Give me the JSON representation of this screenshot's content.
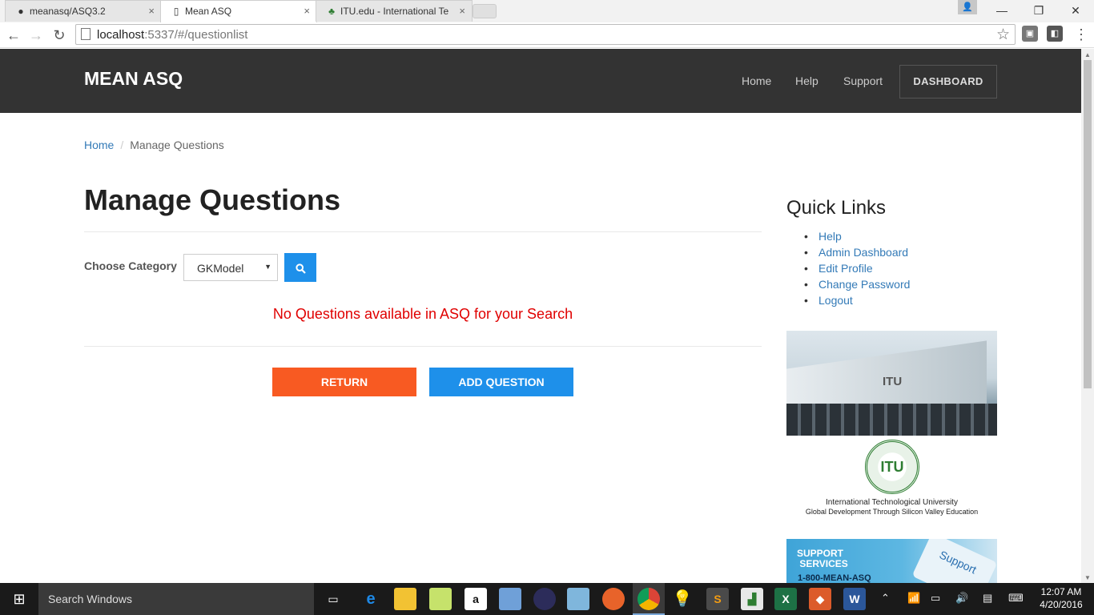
{
  "browser": {
    "tabs": [
      {
        "title": "meanasq/ASQ3.2",
        "icon": "github-icon",
        "active": false
      },
      {
        "title": "Mean ASQ",
        "icon": "page-icon",
        "active": true
      },
      {
        "title": "ITU.edu - International Te",
        "icon": "itu-favicon-icon",
        "active": false
      }
    ],
    "tab_close": "×",
    "url_host": "localhost",
    "url_rest": ":5337/#/questionlist",
    "window_controls": {
      "minimize": "—",
      "restore": "❐",
      "close": "✕"
    }
  },
  "navbar": {
    "brand": "MEAN ASQ",
    "links": [
      "Home",
      "Help",
      "Support"
    ],
    "dashboard_label": "DASHBOARD"
  },
  "breadcrumb": {
    "home": "Home",
    "separator": "/",
    "current": "Manage Questions"
  },
  "main": {
    "title": "Manage Questions",
    "category_label": "Choose Category",
    "category_selected": "GKModel",
    "no_questions_message": "No Questions available in ASQ for your Search",
    "return_label": "RETURN",
    "add_question_label": "ADD QUESTION"
  },
  "sidebar": {
    "title": "Quick Links",
    "links": [
      "Help",
      "Admin Dashboard",
      "Edit Profile",
      "Change Password",
      "Logout"
    ],
    "photo_sign": "ITU",
    "seal_text": "ITU",
    "university_name": "International Technological University",
    "university_tagline": "Global Development Through Silicon Valley Education",
    "support_title_1": "SUPPORT",
    "support_title_2": "SERVICES",
    "support_phone": "1-800-MEAN-ASQ",
    "support_key": "Support"
  },
  "taskbar": {
    "search_placeholder": "Search Windows",
    "time": "12:07 AM",
    "date": "4/20/2016"
  },
  "colors": {
    "navbar_bg": "#333333",
    "link": "#337ab7",
    "primary_button": "#1e90ea",
    "return_button": "#f85a22",
    "error_text": "#e00000"
  }
}
